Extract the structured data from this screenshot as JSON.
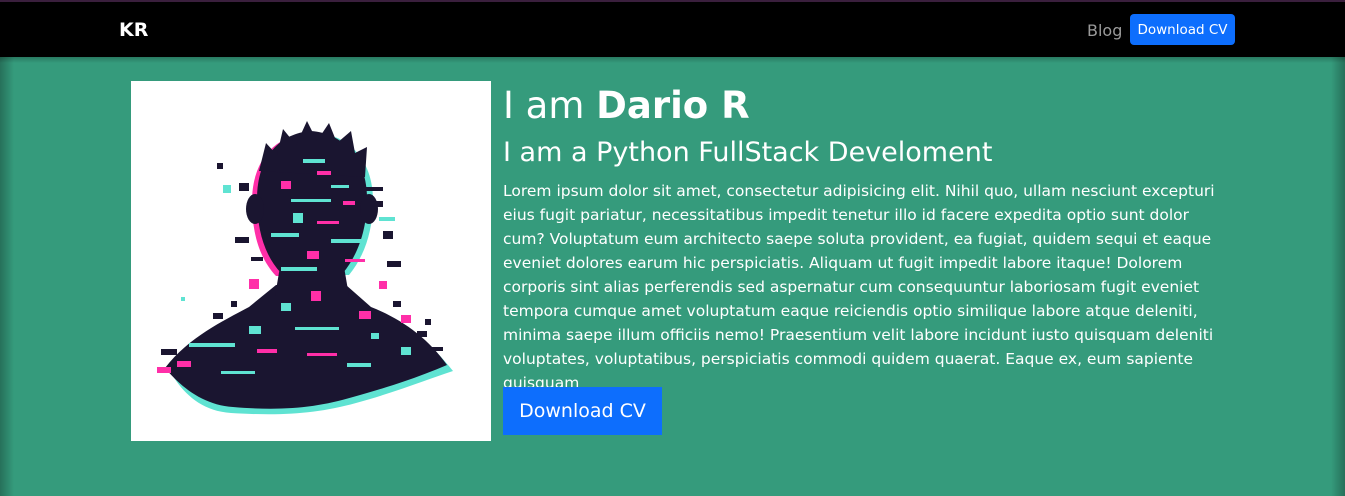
{
  "navbar": {
    "brand": "KR",
    "blog_label": "Blog",
    "download_label": "Download CV"
  },
  "hero": {
    "title_prefix": "I am ",
    "title_name": "Dario R",
    "subtitle": "I am a Python FullStack Develoment",
    "description": "Lorem ipsum dolor sit amet, consectetur adipisicing elit. Nihil quo, ullam nesciunt excepturi eius fugit pariatur, necessitatibus impedit tenetur illo id facere expedita optio sunt dolor cum? Voluptatum eum architecto saepe soluta provident, ea fugiat, quidem sequi et eaque eveniet dolores earum hic perspiciatis. Aliquam ut fugit impedit labore itaque! Dolorem corporis sint alias perferendis sed aspernatur cum consequuntur laboriosam fugit eveniet tempora cumque amet voluptatum eaque reiciendis optio similique labore atque deleniti, minima saepe illum officiis nemo! Praesentium velit labore incidunt iusto quisquam deleniti voluptates, voluptatibus, perspiciatis commodi quidem quaerat. Eaque ex, eum sapiente quisquam",
    "download_label": "Download CV",
    "portrait_icon": "glitch-silhouette-portrait"
  },
  "colors": {
    "page_background": "#359b7c",
    "navbar_background": "#000000",
    "button_primary": "#0d6efd",
    "glitch_cyan": "#5fe3d2",
    "glitch_magenta": "#ff2fa8",
    "silhouette": "#1a1530"
  }
}
